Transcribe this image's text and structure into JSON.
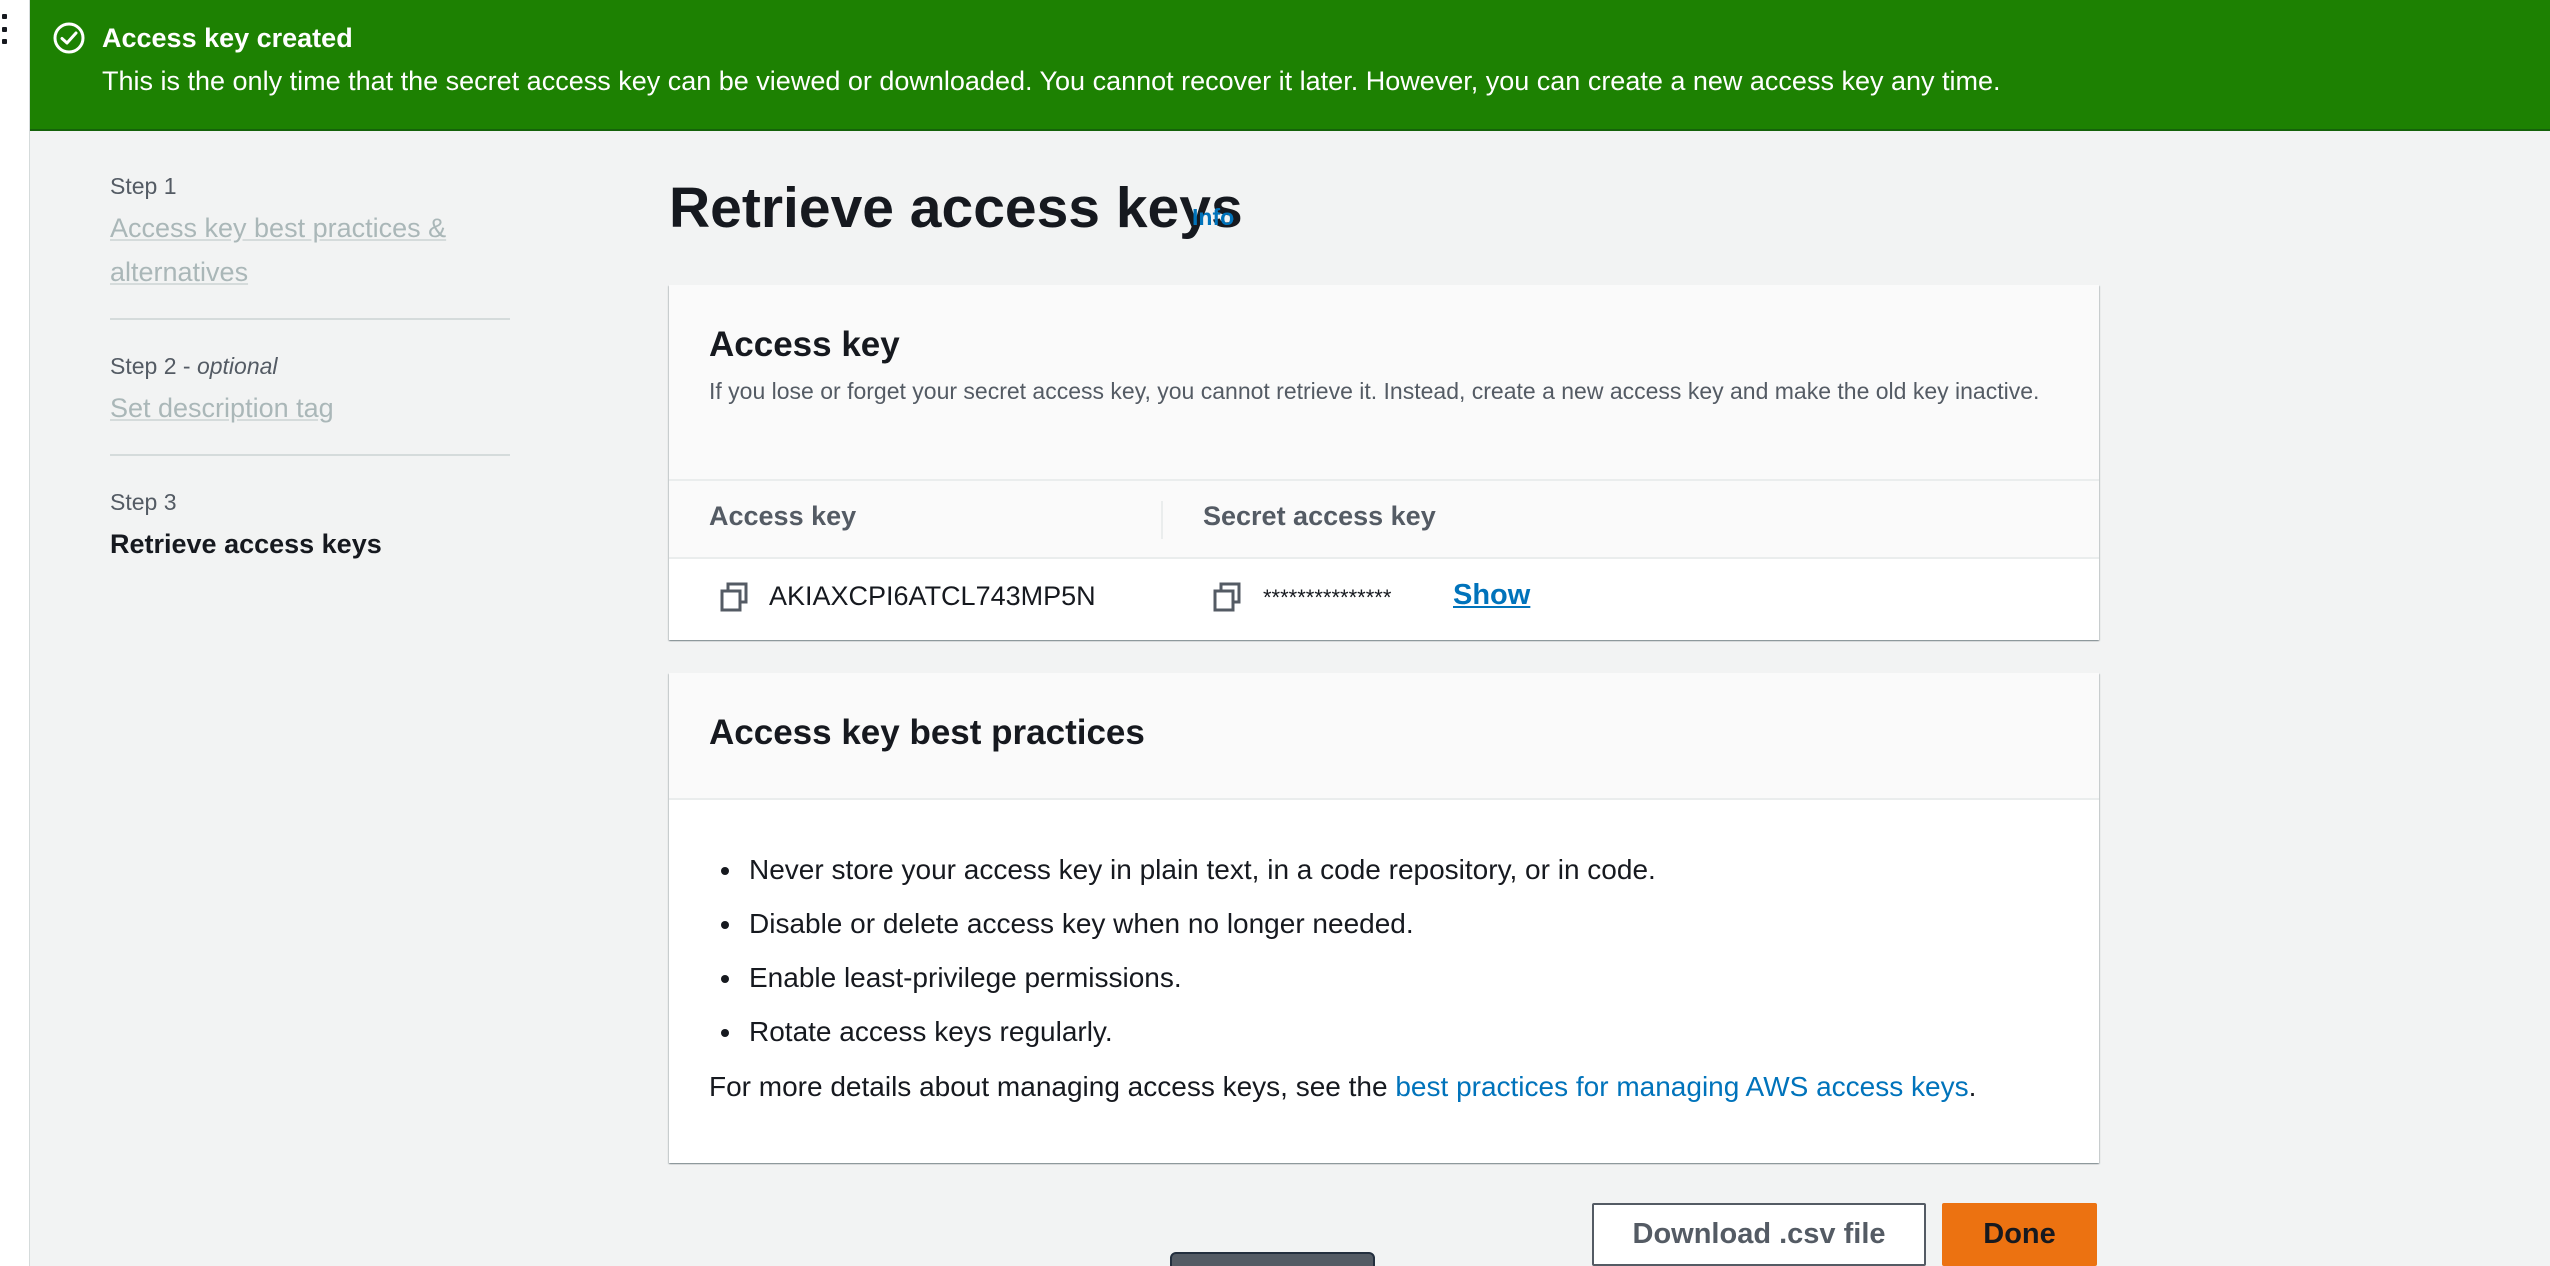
{
  "flash": {
    "title": "Access key created",
    "message": "This is the only time that the secret access key can be viewed or downloaded. You cannot recover it later. However, you can create a new access key any time.",
    "icon": "check-circle-icon",
    "color": "#1d8102"
  },
  "steps": [
    {
      "label": "Step 1",
      "optional": "",
      "title": "Access key best practices & alternatives"
    },
    {
      "label": "Step 2",
      "optional": "optional",
      "title": "Set description tag"
    },
    {
      "label": "Step 3",
      "optional": "",
      "title": "Retrieve access keys"
    }
  ],
  "page": {
    "title": "Retrieve access keys",
    "info": "Info"
  },
  "access_key_panel": {
    "title": "Access key",
    "description": "If you lose or forget your secret access key, you cannot retrieve it. Instead, create a new access key and make the old key inactive.",
    "columns": [
      "Access key",
      "Secret access key"
    ],
    "access_key_value": "AKIAXCPI6ATCL743MP5N",
    "secret_masked": "***************",
    "show_label": "Show"
  },
  "best_practices_panel": {
    "title": "Access key best practices",
    "items": [
      "Never store your access key in plain text, in a code repository, or in code.",
      "Disable or delete access key when no longer needed.",
      "Enable least-privilege permissions.",
      "Rotate access keys regularly."
    ],
    "more_prefix": "For more details about managing access keys, see the ",
    "more_link": "best practices for managing AWS access keys",
    "more_suffix": "."
  },
  "actions": {
    "download_label": "Download .csv file",
    "done_label": "Done"
  },
  "colors": {
    "link": "#0073bb",
    "primary_button": "#ec7211"
  }
}
